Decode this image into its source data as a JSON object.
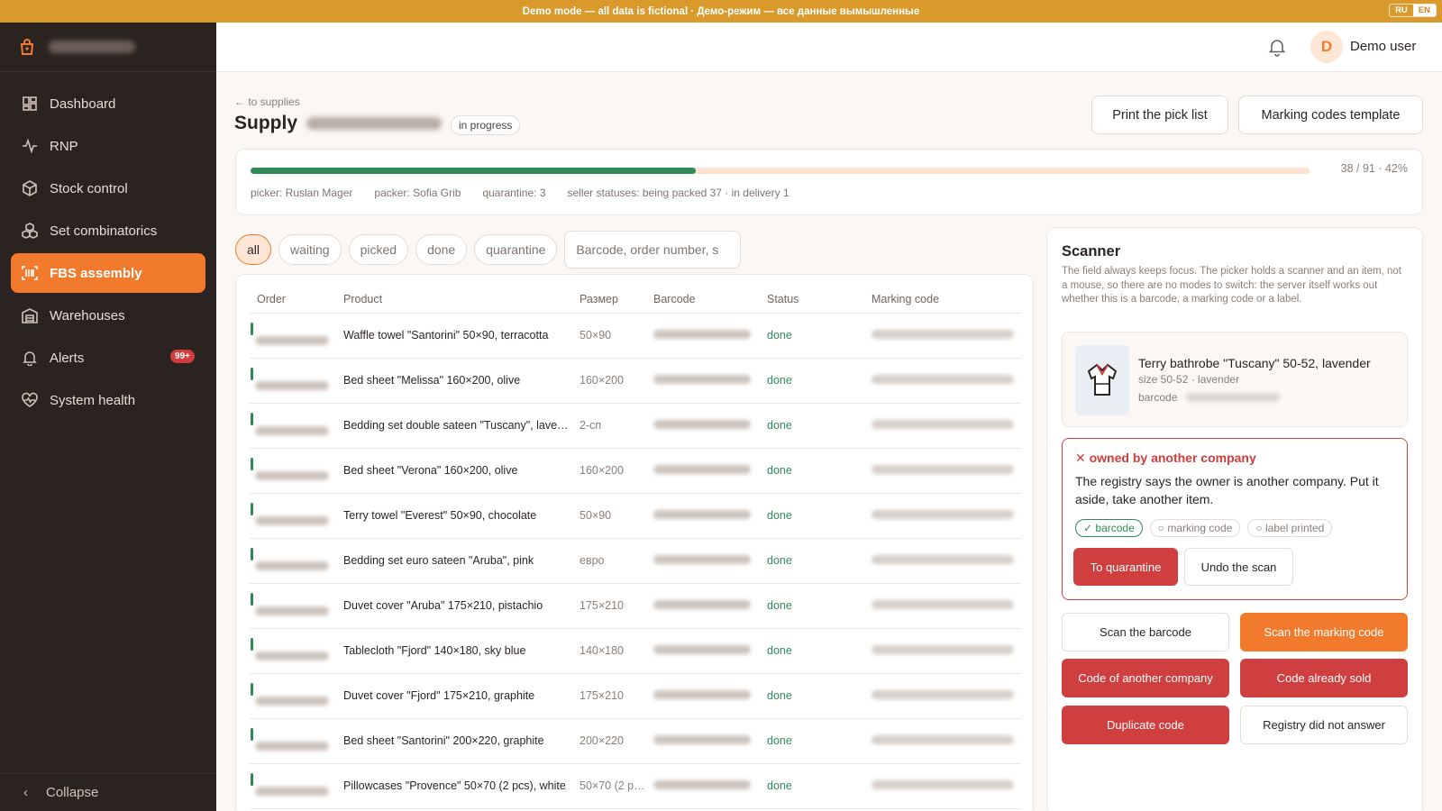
{
  "banner": {
    "text": "Demo mode — all data is fictional · Демо-режим — все данные вымышленные",
    "lang_ru": "RU",
    "lang_en": "EN"
  },
  "sidebar": {
    "items": [
      {
        "label": "Dashboard",
        "icon": "dashboard-icon"
      },
      {
        "label": "RNP",
        "icon": "activity-icon"
      },
      {
        "label": "Stock control",
        "icon": "box-icon"
      },
      {
        "label": "Set combinatorics",
        "icon": "boxes-icon"
      },
      {
        "label": "FBS assembly",
        "icon": "scan-icon",
        "active": true
      },
      {
        "label": "Warehouses",
        "icon": "warehouse-icon"
      },
      {
        "label": "Alerts",
        "icon": "bell-icon",
        "badge": "99+"
      },
      {
        "label": "System health",
        "icon": "heart-pulse-icon"
      }
    ],
    "collapse_label": "Collapse"
  },
  "topbar": {
    "avatar_letter": "D",
    "user_name": "Demo user"
  },
  "page": {
    "back_link": "← to supplies",
    "title": "Supply",
    "status": "in progress",
    "print_button": "Print the pick list",
    "template_button": "Marking codes template"
  },
  "progress": {
    "done": 38,
    "total": 91,
    "percent": 42,
    "label": "38 / 91 · 42%",
    "picker": "picker: Ruslan Mager",
    "packer": "packer: Sofia Grib",
    "quarantine": "quarantine: 3",
    "seller_statuses": "seller statuses: being packed 37 · in delivery 1"
  },
  "filters": {
    "chips": [
      "all",
      "waiting",
      "picked",
      "done",
      "quarantine"
    ],
    "active": "all",
    "search_placeholder": "Barcode, order number, s"
  },
  "table": {
    "headers": [
      "Order",
      "Product",
      "Размер",
      "Barcode",
      "Status",
      "Marking code"
    ],
    "rows": [
      {
        "product": "Waffle towel \"Santorini\" 50×90, terracotta",
        "size": "50×90",
        "status": "done"
      },
      {
        "product": "Bed sheet \"Melissa\" 160×200, olive",
        "size": "160×200",
        "status": "done"
      },
      {
        "product": "Bedding set double sateen \"Tuscany\", lavender",
        "size": "2-сп",
        "status": "done"
      },
      {
        "product": "Bed sheet \"Verona\" 160×200, olive",
        "size": "160×200",
        "status": "done"
      },
      {
        "product": "Terry towel \"Everest\" 50×90, chocolate",
        "size": "50×90",
        "status": "done"
      },
      {
        "product": "Bedding set euro sateen \"Aruba\", pink",
        "size": "евро",
        "status": "done"
      },
      {
        "product": "Duvet cover \"Aruba\" 175×210, pistachio",
        "size": "175×210",
        "status": "done"
      },
      {
        "product": "Tablecloth \"Fjord\" 140×180, sky blue",
        "size": "140×180",
        "status": "done"
      },
      {
        "product": "Duvet cover \"Fjord\" 175×210, graphite",
        "size": "175×210",
        "status": "done"
      },
      {
        "product": "Bed sheet \"Santorini\" 200×220, graphite",
        "size": "200×220",
        "status": "done"
      },
      {
        "product": "Pillowcases \"Provence\" 50×70 (2 pcs), white",
        "size": "50×70 (2 pcs)",
        "status": "done"
      }
    ]
  },
  "scanner": {
    "title": "Scanner",
    "help": "The field always keeps focus. The picker holds a scanner and an item, not a mouse, so there are no modes to switch: the server itself works out whether this is a barcode, a marking code or a label.",
    "item": {
      "name": "Terry bathrobe \"Tuscany\" 50-52, lavender",
      "sub": "size 50-52 · lavender",
      "barcode_label": "barcode"
    },
    "error": {
      "title": "✕ owned by another company",
      "text": "The registry says the owner is another company. Put it aside, take another item.",
      "steps": [
        "✓ barcode",
        "○ marking code",
        "○ label printed"
      ],
      "primary": "To quarantine",
      "secondary": "Undo the scan"
    },
    "actions": [
      "Scan the barcode",
      "Scan the marking code",
      "Code of another company",
      "Code already sold",
      "Duplicate code",
      "Registry did not answer"
    ]
  },
  "colors": {
    "accent": "#f27a2c",
    "sidebar_bg": "#2b2320",
    "banner": "#d99a2b",
    "success": "#2e8b57",
    "danger": "#cf3f3f"
  }
}
